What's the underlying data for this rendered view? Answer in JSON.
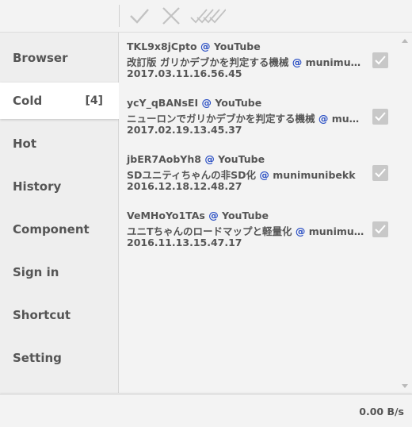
{
  "toolbar": {
    "buttons": [
      {
        "name": "check",
        "icon": "check-icon"
      },
      {
        "name": "close",
        "icon": "close-icon"
      },
      {
        "name": "check-all",
        "icon": "double-check-icon"
      }
    ]
  },
  "sidebar": {
    "items": [
      {
        "label": "Browser",
        "count": ""
      },
      {
        "label": "Cold",
        "count": "[4]"
      },
      {
        "label": "Hot",
        "count": ""
      },
      {
        "label": "History",
        "count": ""
      },
      {
        "label": "Component",
        "count": ""
      },
      {
        "label": "Sign in",
        "count": ""
      },
      {
        "label": "Shortcut",
        "count": ""
      },
      {
        "label": "Setting",
        "count": ""
      }
    ],
    "active_index": 1
  },
  "list": {
    "items": [
      {
        "id": "TKL9x8jCpto",
        "at": "@",
        "source": "YouTube",
        "title": "改訂版 ガリかデブかを判定する機械",
        "author": "munimunibekk",
        "date": "2017.03.11.16.56.45",
        "checked": true
      },
      {
        "id": "ycY_qBANsEI",
        "at": "@",
        "source": "YouTube",
        "title": "ニューロンでガリかデブかを判定する機械",
        "author": "munimunibekk",
        "date": "2017.02.19.13.45.37",
        "checked": true
      },
      {
        "id": "jbER7AobYh8",
        "at": "@",
        "source": "YouTube",
        "title": "SDユニティちゃんの非SD化",
        "author": "munimunibekk",
        "date": "2016.12.18.12.48.27",
        "checked": true
      },
      {
        "id": "VeMHoYo1TAs",
        "at": "@",
        "source": "YouTube",
        "title": "ユニTちゃんのロードマップと軽量化",
        "author": "munimunibekk",
        "date": "2016.11.13.15.47.17",
        "checked": true
      }
    ]
  },
  "footer": {
    "speed": "0.00 B/s"
  },
  "colors": {
    "accent_link": "#2a4fc4",
    "text": "#555555",
    "checkbox": "#c8c8c8"
  }
}
